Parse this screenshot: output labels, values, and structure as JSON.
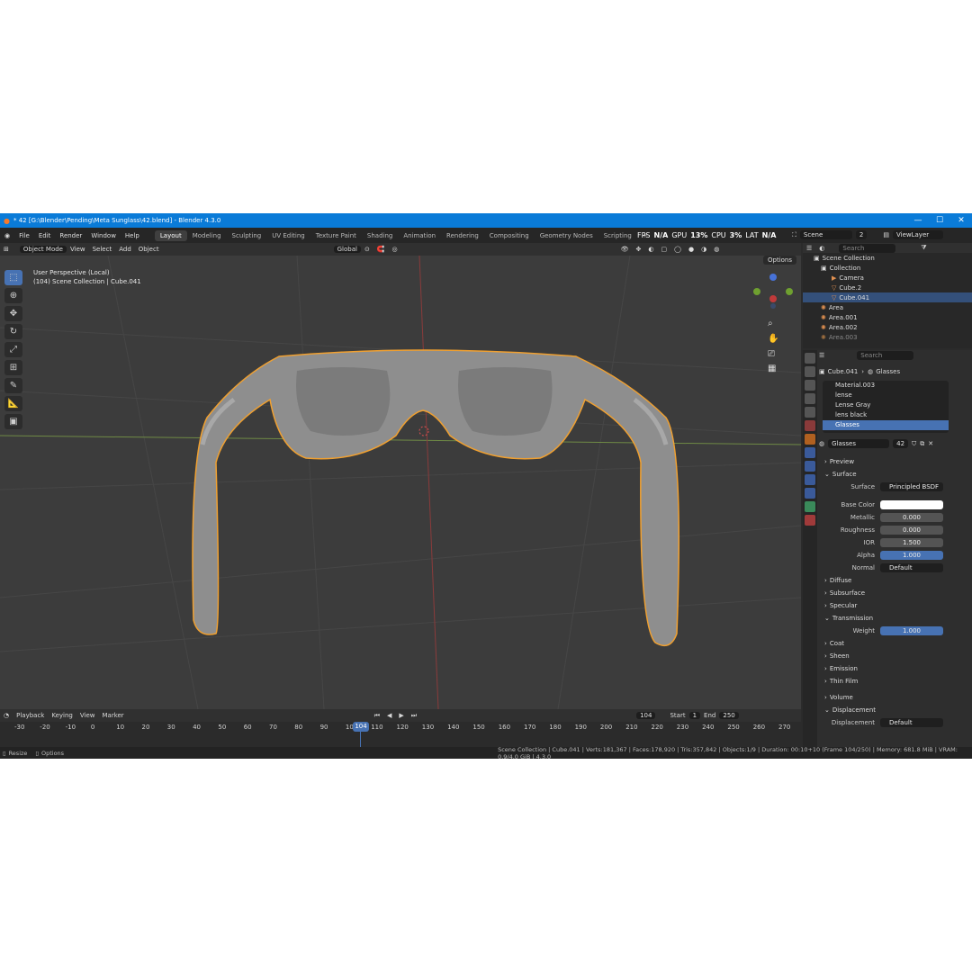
{
  "window": {
    "title": "* 42 [G:\\Blender\\Pending\\Meta Sunglass\\42.blend] - Blender 4.3.0"
  },
  "menu": [
    "File",
    "Edit",
    "Render",
    "Window",
    "Help"
  ],
  "workspaces": [
    "Layout",
    "Modeling",
    "Sculpting",
    "UV Editing",
    "Texture Paint",
    "Shading",
    "Animation",
    "Rendering",
    "Compositing",
    "Geometry Nodes",
    "Scripting",
    "+"
  ],
  "perf": {
    "fps_label": "FPS",
    "fps": "N/A",
    "gpu_label": "GPU",
    "gpu": "13%",
    "cpu_label": "CPU",
    "cpu": "3%",
    "lat_label": "LAT",
    "lat": "N/A"
  },
  "scene": {
    "name": "Scene",
    "users": "2",
    "view_layer": "ViewLayer"
  },
  "header": {
    "mode": "Object Mode",
    "view": "View",
    "select": "Select",
    "add": "Add",
    "object": "Object",
    "orientation": "Global",
    "options": "Options"
  },
  "viewport": {
    "perspective": "User Perspective (Local)",
    "collection_info": "(104) Scene Collection | Cube.041"
  },
  "outliner": {
    "search_placeholder": "Search",
    "items": [
      {
        "label": "Scene Collection"
      },
      {
        "label": "Collection"
      },
      {
        "label": "Camera"
      },
      {
        "label": "Cube.2"
      },
      {
        "label": "Cube.041"
      },
      {
        "label": "Area"
      },
      {
        "label": "Area.001"
      },
      {
        "label": "Area.002"
      },
      {
        "label": "Area.003"
      }
    ]
  },
  "properties": {
    "search_placeholder": "Search",
    "breadcrumb_object": "Cube.041",
    "breadcrumb_material": "Glasses",
    "materials": [
      "Material.003",
      "lense",
      "Lense Gray",
      "lens black",
      "Glasses"
    ],
    "active_material": "Glasses",
    "material_users": "42",
    "sections": {
      "preview": "Preview",
      "surface": "Surface",
      "diffuse": "Diffuse",
      "subsurface": "Subsurface",
      "specular": "Specular",
      "transmission": "Transmission",
      "coat": "Coat",
      "sheen": "Sheen",
      "emission": "Emission",
      "thin_film": "Thin Film",
      "volume": "Volume",
      "displacement": "Displacement"
    },
    "surface": {
      "label": "Surface",
      "value": "Principled BSDF"
    },
    "fields": [
      {
        "label": "Base Color",
        "value": ""
      },
      {
        "label": "Metallic",
        "value": "0.000"
      },
      {
        "label": "Roughness",
        "value": "0.000"
      },
      {
        "label": "IOR",
        "value": "1.500"
      },
      {
        "label": "Alpha",
        "value": "1.000"
      },
      {
        "label": "Normal",
        "value": "Default"
      }
    ],
    "weight": {
      "label": "Weight",
      "value": "1.000"
    },
    "displacement": {
      "label": "Displacement",
      "value": "Default"
    }
  },
  "timeline": {
    "playback": "Playback",
    "keying": "Keying",
    "view": "View",
    "marker": "Marker",
    "current_frame": "104",
    "start_label": "Start",
    "start": "1",
    "end_label": "End",
    "end": "250",
    "ticks": [
      "-30",
      "-20",
      "-10",
      "0",
      "10",
      "20",
      "30",
      "40",
      "50",
      "60",
      "70",
      "80",
      "90",
      "100",
      "110",
      "120",
      "130",
      "140",
      "150",
      "160",
      "170",
      "180",
      "190",
      "200",
      "210",
      "220",
      "230",
      "240",
      "250",
      "260",
      "270"
    ]
  },
  "status": {
    "resize": "Resize",
    "options": "Options",
    "stats": "Scene Collection | Cube.041 | Verts:181,367 | Faces:178,920 | Tris:357,842 | Objects:1/9 | Duration: 00:10+10 (Frame 104/250) | Memory: 681.8 MiB | VRAM: 0.9/4.0 GiB | 4.3.0"
  },
  "colors": {
    "accent": "#4772b3",
    "titlebar": "#0a7bd8",
    "selection_outline": "#f0a030"
  }
}
